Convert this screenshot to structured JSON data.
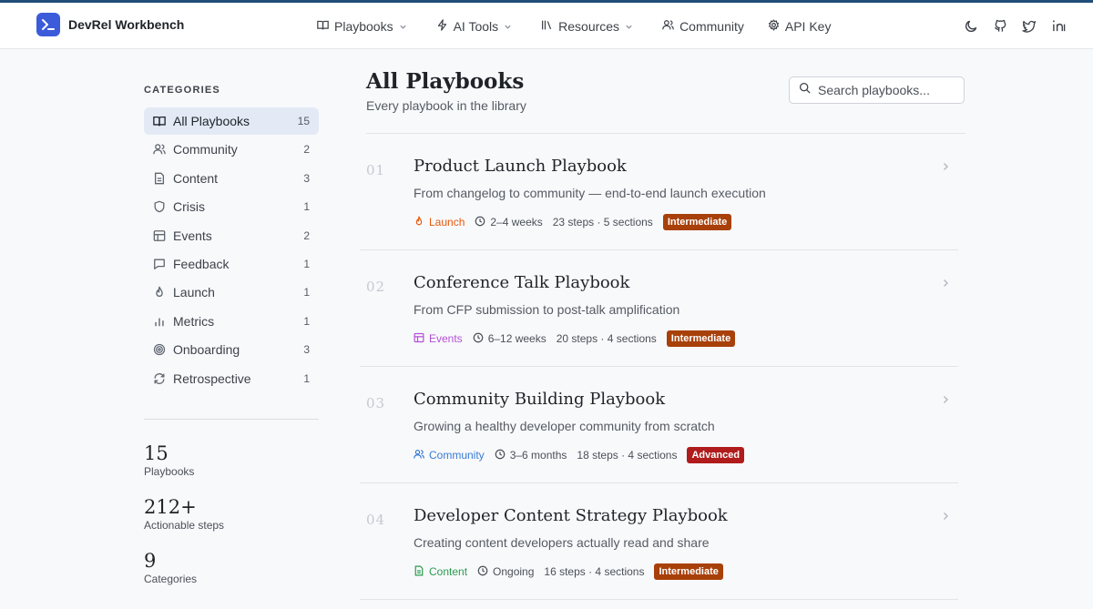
{
  "brand": {
    "name": "DevRel Workbench"
  },
  "nav": [
    {
      "label": "Playbooks",
      "icon": "book-open-icon",
      "dropdown": true
    },
    {
      "label": "AI Tools",
      "icon": "bolt-icon",
      "dropdown": true
    },
    {
      "label": "Resources",
      "icon": "library-icon",
      "dropdown": true
    },
    {
      "label": "Community",
      "icon": "users-icon",
      "dropdown": false
    },
    {
      "label": "API Key",
      "icon": "gear-icon",
      "dropdown": false
    }
  ],
  "header_icons": [
    "moon-icon",
    "github-icon",
    "twitter-icon",
    "linkedin-icon"
  ],
  "sidebar": {
    "title": "CATEGORIES",
    "items": [
      {
        "label": "All Playbooks",
        "count": "15",
        "icon": "book-open-icon",
        "active": true
      },
      {
        "label": "Community",
        "count": "2",
        "icon": "users-icon"
      },
      {
        "label": "Content",
        "count": "3",
        "icon": "file-text-icon"
      },
      {
        "label": "Crisis",
        "count": "1",
        "icon": "shield-icon"
      },
      {
        "label": "Events",
        "count": "2",
        "icon": "calendar-icon"
      },
      {
        "label": "Feedback",
        "count": "1",
        "icon": "message-square-icon"
      },
      {
        "label": "Launch",
        "count": "1",
        "icon": "flame-icon"
      },
      {
        "label": "Metrics",
        "count": "1",
        "icon": "bar-chart-icon"
      },
      {
        "label": "Onboarding",
        "count": "3",
        "icon": "target-icon"
      },
      {
        "label": "Retrospective",
        "count": "1",
        "icon": "refresh-icon"
      }
    ],
    "stats": [
      {
        "value": "15",
        "label": "Playbooks"
      },
      {
        "value": "212+",
        "label": "Actionable steps"
      },
      {
        "value": "9",
        "label": "Categories"
      }
    ]
  },
  "main": {
    "title": "All Playbooks",
    "subtitle": "Every playbook in the library",
    "search": {
      "placeholder": "Search playbooks...",
      "value": ""
    },
    "playbooks": [
      {
        "index": "01",
        "title": "Product Launch Playbook",
        "description": "From changelog to community — end-to-end launch execution",
        "category": "Launch",
        "category_icon": "flame-icon",
        "category_color": "#e8590c",
        "duration": "2–4 weeks",
        "steps": "23 steps · 5 sections",
        "level": "Intermediate",
        "level_color": "#a8400a"
      },
      {
        "index": "02",
        "title": "Conference Talk Playbook",
        "description": "From CFP submission to post-talk amplification",
        "category": "Events",
        "category_icon": "calendar-icon",
        "category_color": "#b44fd6",
        "duration": "6–12 weeks",
        "steps": "20 steps · 4 sections",
        "level": "Intermediate",
        "level_color": "#a8400a"
      },
      {
        "index": "03",
        "title": "Community Building Playbook",
        "description": "Growing a healthy developer community from scratch",
        "category": "Community",
        "category_icon": "users-icon",
        "category_color": "#3a7bd5",
        "duration": "3–6 months",
        "steps": "18 steps · 4 sections",
        "level": "Advanced",
        "level_color": "#b01c1c"
      },
      {
        "index": "04",
        "title": "Developer Content Strategy Playbook",
        "description": "Creating content developers actually read and share",
        "category": "Content",
        "category_icon": "file-text-icon",
        "category_color": "#2b9b4f",
        "duration": "Ongoing",
        "steps": "16 steps · 4 sections",
        "level": "Intermediate",
        "level_color": "#a8400a"
      }
    ]
  }
}
